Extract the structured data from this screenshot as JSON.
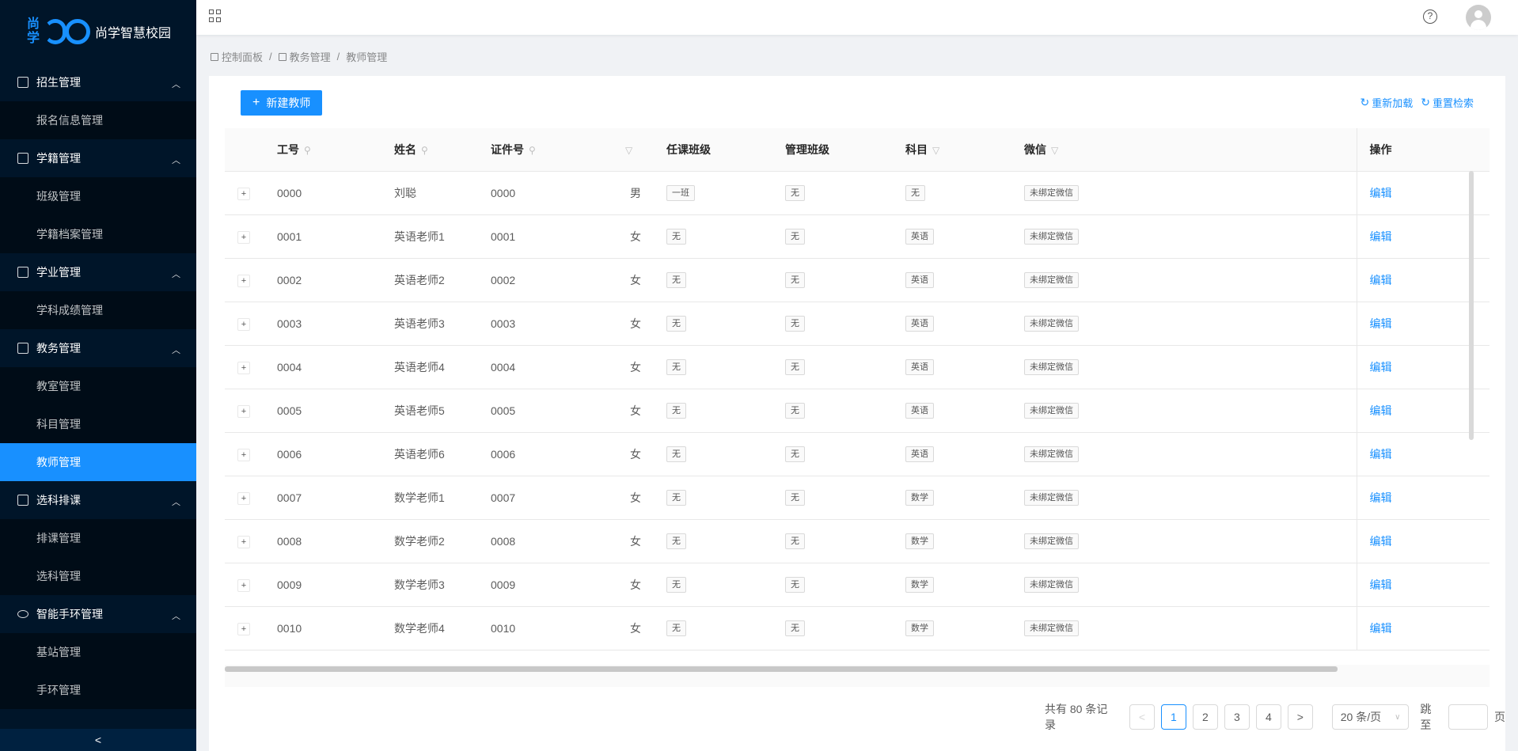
{
  "app": {
    "logo_chars": [
      "尚",
      "学"
    ],
    "title": "尚学智慧校园"
  },
  "sidebar": {
    "groups": [
      {
        "label": "招生管理",
        "icon": "enroll-icon",
        "items": [
          "报名信息管理"
        ]
      },
      {
        "label": "学籍管理",
        "icon": "id-card-icon",
        "items": [
          "班级管理",
          "学籍档案管理"
        ]
      },
      {
        "label": "学业管理",
        "icon": "edit-doc-icon",
        "items": [
          "学科成绩管理"
        ]
      },
      {
        "label": "教务管理",
        "icon": "calendar-icon",
        "items": [
          "教室管理",
          "科目管理",
          "教师管理"
        ]
      },
      {
        "label": "选科排课",
        "icon": "calendar-icon",
        "items": [
          "排课管理",
          "选科管理"
        ]
      },
      {
        "label": "智能手环管理",
        "icon": "eye-icon",
        "items": [
          "基站管理",
          "手环管理"
        ]
      }
    ],
    "active_item": "教师管理",
    "collapse_symbol": "<"
  },
  "header": {
    "help_symbol": "?"
  },
  "breadcrumb": {
    "items": [
      "控制面板",
      "教务管理",
      "教师管理"
    ],
    "separator": "/"
  },
  "toolbar": {
    "new_label": "新建教师",
    "reload_label": "重新加载",
    "reset_label": "重置检索",
    "plus": "+"
  },
  "table": {
    "columns": [
      "",
      "工号",
      "姓名",
      "证件号",
      "",
      "任课班级",
      "管理班级",
      "科目",
      "微信",
      "操作"
    ],
    "rows": [
      {
        "id": "0000",
        "name": "刘聪",
        "cert": "0000",
        "gender": "男",
        "teach_class": "一班",
        "manage_class": "无",
        "subject": "无",
        "wechat": "未绑定微信",
        "action": "编辑"
      },
      {
        "id": "0001",
        "name": "英语老师1",
        "cert": "0001",
        "gender": "女",
        "teach_class": "无",
        "manage_class": "无",
        "subject": "英语",
        "wechat": "未绑定微信",
        "action": "编辑"
      },
      {
        "id": "0002",
        "name": "英语老师2",
        "cert": "0002",
        "gender": "女",
        "teach_class": "无",
        "manage_class": "无",
        "subject": "英语",
        "wechat": "未绑定微信",
        "action": "编辑"
      },
      {
        "id": "0003",
        "name": "英语老师3",
        "cert": "0003",
        "gender": "女",
        "teach_class": "无",
        "manage_class": "无",
        "subject": "英语",
        "wechat": "未绑定微信",
        "action": "编辑"
      },
      {
        "id": "0004",
        "name": "英语老师4",
        "cert": "0004",
        "gender": "女",
        "teach_class": "无",
        "manage_class": "无",
        "subject": "英语",
        "wechat": "未绑定微信",
        "action": "编辑"
      },
      {
        "id": "0005",
        "name": "英语老师5",
        "cert": "0005",
        "gender": "女",
        "teach_class": "无",
        "manage_class": "无",
        "subject": "英语",
        "wechat": "未绑定微信",
        "action": "编辑"
      },
      {
        "id": "0006",
        "name": "英语老师6",
        "cert": "0006",
        "gender": "女",
        "teach_class": "无",
        "manage_class": "无",
        "subject": "英语",
        "wechat": "未绑定微信",
        "action": "编辑"
      },
      {
        "id": "0007",
        "name": "数学老师1",
        "cert": "0007",
        "gender": "女",
        "teach_class": "无",
        "manage_class": "无",
        "subject": "数学",
        "wechat": "未绑定微信",
        "action": "编辑"
      },
      {
        "id": "0008",
        "name": "数学老师2",
        "cert": "0008",
        "gender": "女",
        "teach_class": "无",
        "manage_class": "无",
        "subject": "数学",
        "wechat": "未绑定微信",
        "action": "编辑"
      },
      {
        "id": "0009",
        "name": "数学老师3",
        "cert": "0009",
        "gender": "女",
        "teach_class": "无",
        "manage_class": "无",
        "subject": "数学",
        "wechat": "未绑定微信",
        "action": "编辑"
      },
      {
        "id": "0010",
        "name": "数学老师4",
        "cert": "0010",
        "gender": "女",
        "teach_class": "无",
        "manage_class": "无",
        "subject": "数学",
        "wechat": "未绑定微信",
        "action": "编辑"
      }
    ]
  },
  "pagination": {
    "total_text": "共有 80 条记录",
    "pages": [
      "1",
      "2",
      "3",
      "4"
    ],
    "current": "1",
    "prev": "<",
    "next": ">",
    "page_size": "20 条/页",
    "jump_label": "跳至",
    "jump_suffix": "页"
  },
  "colors": {
    "accent": "#1890ff",
    "sidebar_bg": "#001529",
    "submenu_bg": "#000c17"
  }
}
